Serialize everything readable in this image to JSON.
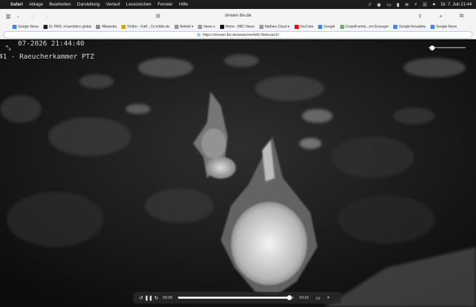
{
  "menubar": {
    "app": "Safari",
    "items": [
      "Ablage",
      "Bearbeiten",
      "Darstellung",
      "Verlauf",
      "Lesezeichen",
      "Fenster",
      "Hilfe"
    ],
    "clock": "Di. 7. Juli  21:44"
  },
  "toolbar": {
    "tab_title": "stream.lbv.de"
  },
  "favorites": [
    {
      "label": "Google News",
      "color": "#4285f4"
    },
    {
      "label": "EL PAÍS: el periódico global",
      "color": "#222222"
    },
    {
      "label": "Wikipedia",
      "color": "#888888"
    },
    {
      "label": "Tchibo – Kaff... Zu tchibo.de",
      "color": "#d9a400"
    },
    {
      "label": "Beliebt ▾",
      "color": "#999999"
    },
    {
      "label": "News ▾",
      "color": "#999999"
    },
    {
      "label": "Home - BBC News",
      "color": "#111111"
    },
    {
      "label": "Mathieu Cloud ▾",
      "color": "#999999"
    },
    {
      "label": "YouTube",
      "color": "#ff0000"
    },
    {
      "label": "Google",
      "color": "#4285f4"
    },
    {
      "label": "CrowdFarmin...om Erzeuger",
      "color": "#6bb36b"
    },
    {
      "label": "Google Actualités",
      "color": "#4285f4"
    },
    {
      "label": "Google News",
      "color": "#4285f4"
    }
  ],
  "url": {
    "address": "https://stream.lbv.de/waischenfeld-Webcam2/"
  },
  "video": {
    "osd_date": "07-2026  21:44:40",
    "osd_camera": "41 - Raeucherkammer PTZ",
    "volume_level": 0.05,
    "progress": 0.96,
    "current_time": "03:09",
    "total_time": "03:22"
  }
}
